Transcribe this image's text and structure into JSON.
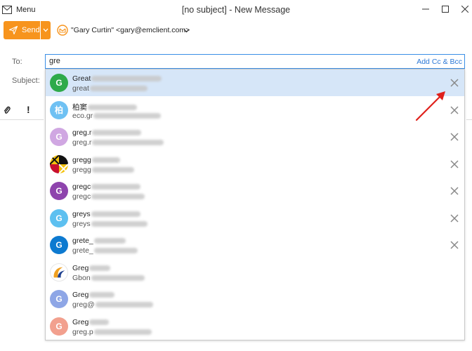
{
  "window": {
    "menu_label": "Menu",
    "title": "[no subject] - New Message"
  },
  "toolbar": {
    "send_label": "Send",
    "from": "\"Gary Curtin\" <gary@emclient.com>"
  },
  "fields": {
    "to_label": "To:",
    "to_value": "gre",
    "add_cc_bcc": "Add Cc & Bcc",
    "subject_label": "Subject:"
  },
  "suggestions": [
    {
      "name": "Great",
      "email": "great",
      "avatar_letter": "G",
      "avatar_color": "#2eaa4a",
      "removable": true,
      "selected": true
    },
    {
      "name": "柏窦",
      "email": "eco.gr",
      "avatar_letter": "柏",
      "avatar_color": "#6fc1f3",
      "removable": true,
      "selected": false
    },
    {
      "name": "greg.r",
      "email": "greg.r",
      "avatar_letter": "G",
      "avatar_color": "#d0a7e2",
      "removable": true,
      "selected": false
    },
    {
      "name": "gregg",
      "email": "gregg",
      "avatar_letter": "",
      "avatar_color": "#c8102e",
      "removable": true,
      "selected": false
    },
    {
      "name": "gregc",
      "email": "gregc",
      "avatar_letter": "G",
      "avatar_color": "#8e44ad",
      "removable": true,
      "selected": false
    },
    {
      "name": "greys",
      "email": "greys",
      "avatar_letter": "G",
      "avatar_color": "#5dc0f0",
      "removable": true,
      "selected": false
    },
    {
      "name": "grete_",
      "email": "grete_",
      "avatar_letter": "G",
      "avatar_color": "#0d7ad0",
      "removable": true,
      "selected": false
    },
    {
      "name": "Greg",
      "email": "Gbon",
      "avatar_letter": "",
      "avatar_color": "#ffffff",
      "removable": false,
      "selected": false
    },
    {
      "name": "Greg",
      "email": "greg@",
      "avatar_letter": "G",
      "avatar_color": "#8ea6e6",
      "removable": false,
      "selected": false
    },
    {
      "name": "Greg",
      "email": "greg.p",
      "avatar_letter": "G",
      "avatar_color": "#f2a08e",
      "removable": false,
      "selected": false
    }
  ],
  "colors": {
    "accent": "#f7941d",
    "link": "#2b78d6",
    "selection": "#d6e6f8",
    "annotation_arrow": "#e0201b"
  }
}
